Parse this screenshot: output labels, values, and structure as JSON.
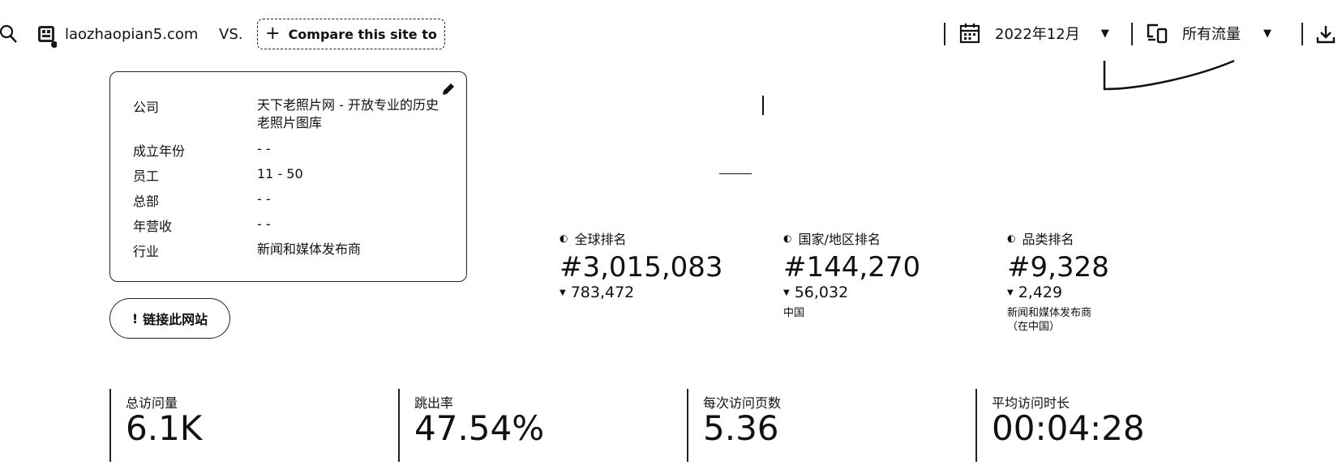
{
  "topbar": {
    "search_icon": "search-icon",
    "site_icon": "site-favicon-icon",
    "domain": "laozhaopian5.com",
    "vs_label": "VS.",
    "compare_label": "Compare this site to",
    "date_icon": "calendar-icon",
    "date_value": "2022年12月",
    "traffic_icon": "devices-icon",
    "traffic_value": "所有流量",
    "download_icon": "download-icon"
  },
  "company": {
    "edit_icon": "pencil-icon",
    "rows": [
      {
        "label": "公司",
        "value": "天下老照片网 - 开放专业的历史老照片图库"
      },
      {
        "label": "成立年份",
        "value": "- -"
      },
      {
        "label": "员工",
        "value": "11 - 50"
      },
      {
        "label": "总部",
        "value": "- -"
      },
      {
        "label": "年营收",
        "value": "- -"
      },
      {
        "label": "行业",
        "value": "新闻和媒体发布商"
      }
    ]
  },
  "backlink": {
    "label": "链接此网站"
  },
  "rankings": [
    {
      "title": "全球排名",
      "value": "#3,015,083",
      "change": "783,472",
      "sub": ""
    },
    {
      "title": "国家/地区排名",
      "value": "#144,270",
      "change": "56,032",
      "sub": "中国"
    },
    {
      "title": "品类排名",
      "value": "#9,328",
      "change": "2,429",
      "sub": "新闻和媒体发布商\n（在中国）"
    }
  ],
  "metrics": [
    {
      "label": "总访问量",
      "value": "6.1K"
    },
    {
      "label": "跳出率",
      "value": "47.54%"
    },
    {
      "label": "每次访问页数",
      "value": "5.36"
    },
    {
      "label": "平均访问时长",
      "value": "00:04:28"
    }
  ]
}
